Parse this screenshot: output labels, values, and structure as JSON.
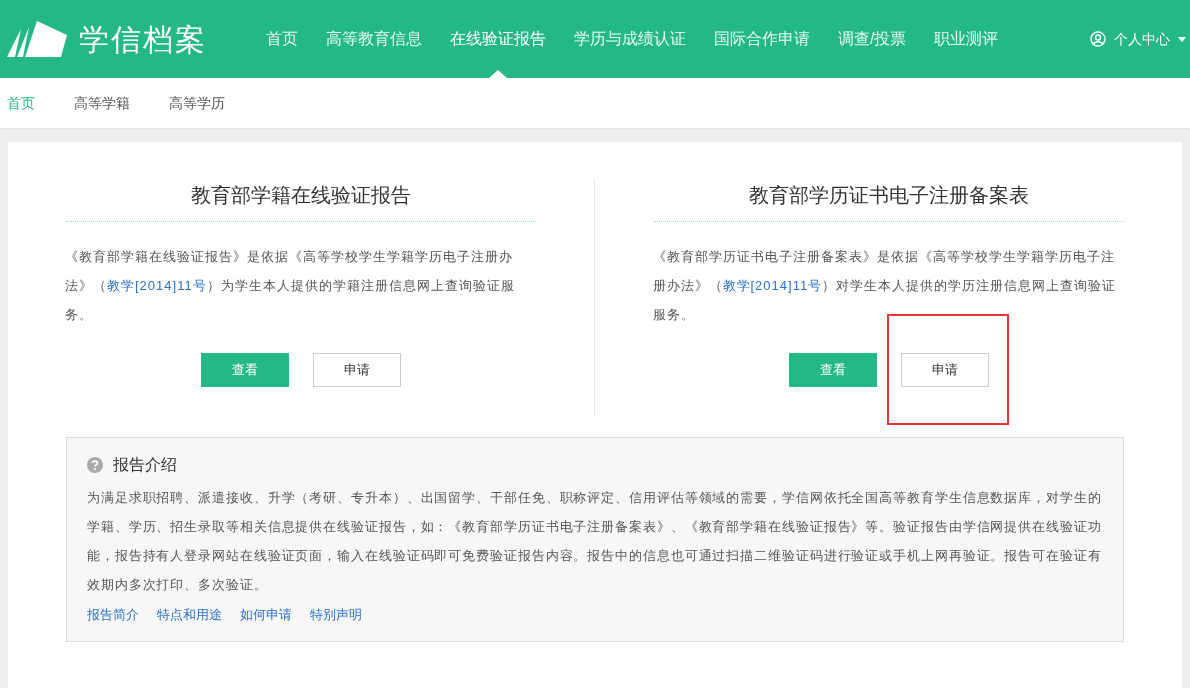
{
  "header": {
    "logo_text": "学信档案",
    "nav": [
      {
        "label": "首页",
        "selected": false
      },
      {
        "label": "高等教育信息",
        "selected": false
      },
      {
        "label": "在线验证报告",
        "selected": true
      },
      {
        "label": "学历与成绩认证",
        "selected": false
      },
      {
        "label": "国际合作申请",
        "selected": false
      },
      {
        "label": "调查/投票",
        "selected": false
      },
      {
        "label": "职业测评",
        "selected": false
      }
    ],
    "user_menu": "个人中心"
  },
  "subnav": [
    {
      "label": "首页",
      "selected": true
    },
    {
      "label": "高等学籍",
      "selected": false
    },
    {
      "label": "高等学历",
      "selected": false
    }
  ],
  "cards": [
    {
      "title": "教育部学籍在线验证报告",
      "description_before": "《教育部学籍在线验证报告》是依据《高等学校学生学籍学历电子注册办法》（",
      "description_link": "教学[2014]11号",
      "description_after": "）为学生本人提供的学籍注册信息网上查询验证服务。",
      "buttons": [
        "查看",
        "申请"
      ],
      "highlighted": false
    },
    {
      "title": "教育部学历证书电子注册备案表",
      "description_before": "《教育部学历证书电子注册备案表》是依据《高等学校学生学籍学历电子注册办法》（",
      "description_link": "教学[2014]11号",
      "description_after": "）对学生本人提供的学历注册信息网上查询验证服务。",
      "buttons": [
        "查看",
        "申请"
      ],
      "highlighted": true
    }
  ],
  "intro": {
    "title": "报告介绍",
    "text": "为满足求职招聘、派遣接收、升学（考研、专升本）、出国留学、干部任免、职称评定、信用评估等领域的需要，学信网依托全国高等教育学生信息数据库，对学生的学籍、学历、招生录取等相关信息提供在线验证报告，如：《教育部学历证书电子注册备案表》、《教育部学籍在线验证报告》等。验证报告由学信网提供在线验证功能，报告持有人登录网站在线验证页面，输入在线验证码即可免费验证报告内容。报告中的信息也可通过扫描二维验证码进行验证或手机上网再验证。报告可在验证有效期内多次打印、多次验证。",
    "links": [
      "报告简介",
      "特点和用途",
      "如何申请",
      "特别声明"
    ]
  }
}
